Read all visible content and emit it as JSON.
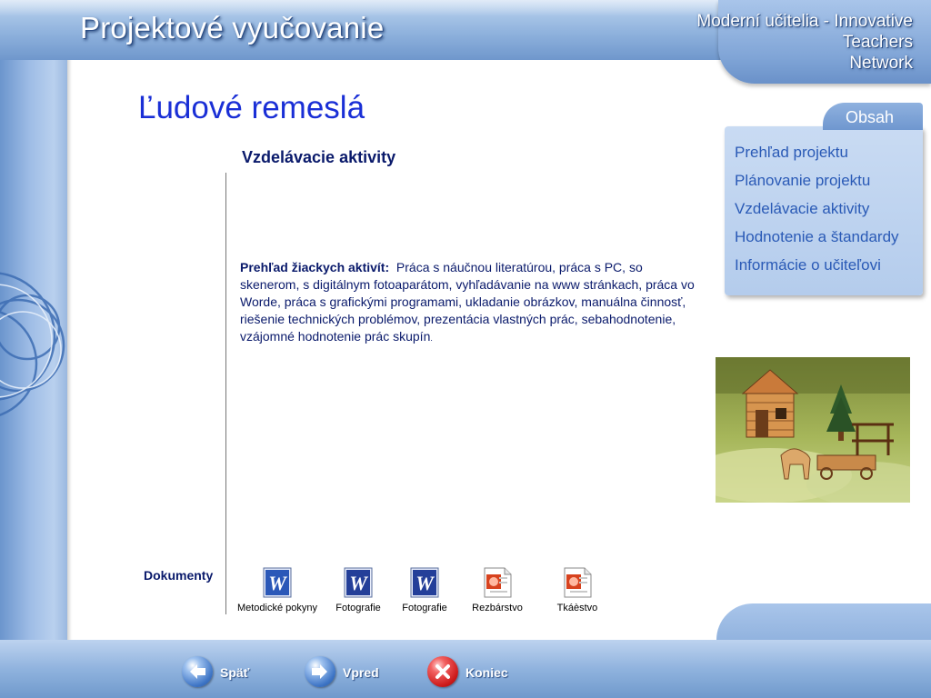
{
  "header": {
    "title": "Projektové vyučovanie",
    "network_lines": [
      "Moderní učitelia - Innovative",
      "Teachers",
      "Network"
    ]
  },
  "main": {
    "page_title": "Ľudové remeslá",
    "section_heading": "Vzdelávacie aktivity",
    "overview_label": "Prehľad žiackych aktivít:",
    "overview_text": "Práca s náučnou literatúrou, práca s PC, so skenerom, s digitálnym fotoaparátom, vyhľadávanie na www stránkach, práca vo Worde, práca s grafickými programami, ukladanie obrázkov, manuálna činnosť, riešenie technických problémov, prezentácia vlastných prác, sebahodnotenie, vzájomné hodnotenie prác skupín",
    "overview_end": "."
  },
  "documents": {
    "label": "Dokumenty",
    "items": [
      {
        "label": "Metodické pokyny",
        "icon": "word-document-icon"
      },
      {
        "label": "Fotografie",
        "icon": "word-document-icon"
      },
      {
        "label": "Fotografie",
        "icon": "word-document-icon"
      },
      {
        "label": "Rezbárstvo",
        "icon": "powerpoint-document-icon"
      },
      {
        "label": "Tkáèstvo",
        "icon": "powerpoint-document-icon"
      }
    ]
  },
  "sidebar": {
    "tab_label": "Obsah",
    "items": [
      {
        "label": "Prehľad projektu"
      },
      {
        "label": "Plánovanie projektu"
      },
      {
        "label": "Vzdelávacie aktivity"
      },
      {
        "label": "Hodnotenie a štandardy"
      },
      {
        "label": "Informácie o učiteľovi"
      }
    ]
  },
  "nav": {
    "back": {
      "label": "Späť",
      "icon": "arrow-left-icon"
    },
    "forward": {
      "label": "Vpred",
      "icon": "arrow-right-icon"
    },
    "end": {
      "label": "Koniec",
      "icon": "close-icon"
    }
  },
  "colors": {
    "accent_blue": "#1a2fd6",
    "text_navy": "#0a1a6b",
    "menu_link": "#2a5ab6",
    "frame_blue": "#8fb2dd"
  }
}
